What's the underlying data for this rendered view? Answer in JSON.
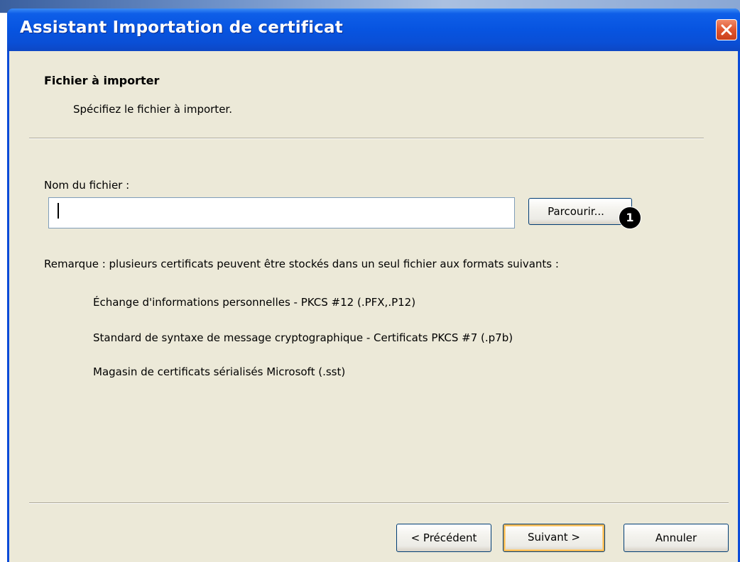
{
  "window": {
    "title": "Assistant Importation de certificat"
  },
  "header": {
    "title": "Fichier à importer",
    "subtitle": "Spécifiez le fichier à importer."
  },
  "file": {
    "label": "Nom du fichier :",
    "value": "",
    "browse_label": "Parcourir...",
    "callout_number": "1"
  },
  "remark": "Remarque : plusieurs certificats peuvent être stockés dans un seul fichier aux formats suivants :",
  "formats": [
    "Échange d'informations personnelles - PKCS #12 (.PFX,.P12)",
    "Standard de syntaxe de message cryptographique - Certificats PKCS #7 (.p7b)",
    "Magasin de certificats sérialisés Microsoft (.sst)"
  ],
  "buttons": {
    "back": "< Précédent",
    "next": "Suivant >",
    "cancel": "Annuler"
  },
  "icons": {
    "close": "close-icon"
  },
  "colors": {
    "titlebar": "#0754e0",
    "dialog_bg": "#ece9d8",
    "close_button": "#e0552e",
    "default_button_highlight": "#f6b954"
  }
}
